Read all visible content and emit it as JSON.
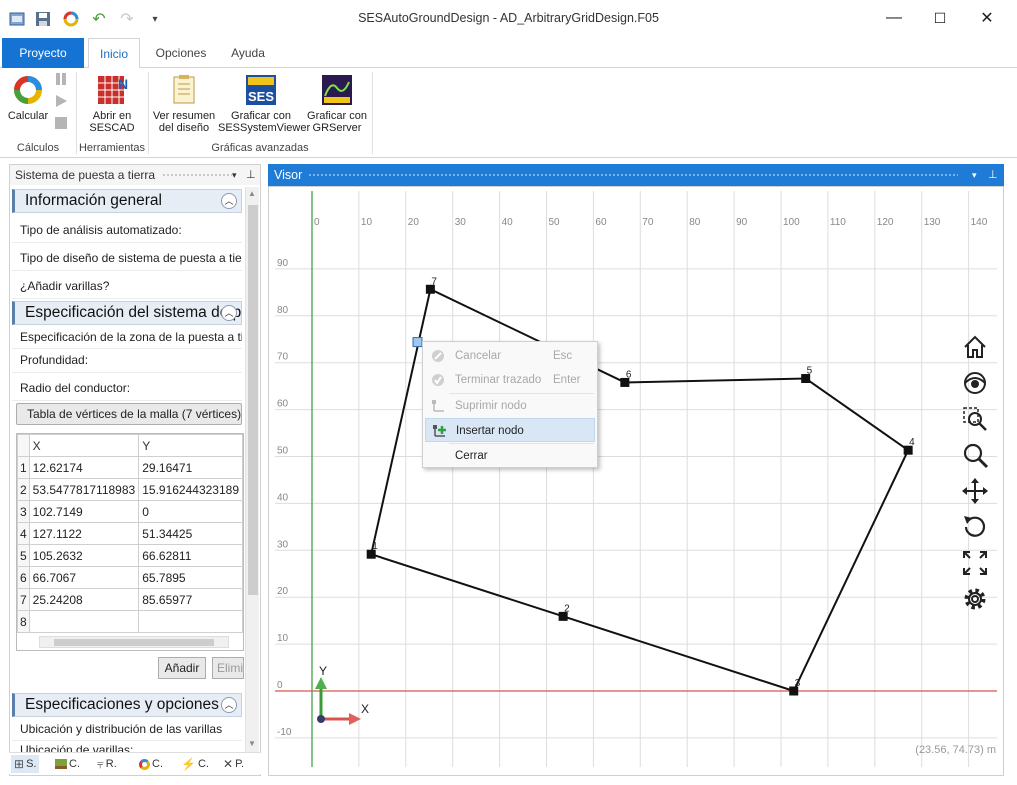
{
  "window": {
    "title": "SESAutoGroundDesign - AD_ArbitraryGridDesign.F05",
    "minimize": "—",
    "maximize": "☐",
    "close": "✕"
  },
  "ribbon": {
    "tabs": [
      "Proyecto",
      "Inicio",
      "Opciones",
      "Ayuda"
    ],
    "buttons": {
      "calcular": "Calcular",
      "abrir1": "Abrir en",
      "abrir2": "SESCAD",
      "resumen1": "Ver resumen",
      "resumen2": "del diseño",
      "sesview1": "Graficar con",
      "sesview2": "SESSystemViewer",
      "grserver1": "Graficar con",
      "grserver2": "GRServer"
    },
    "groups": {
      "calculos": "Cálculos",
      "herramientas": "Herramientas",
      "graficas": "Gráficas avanzadas"
    }
  },
  "left_panel": {
    "title": "Sistema de puesta a tierra",
    "sections": {
      "general": "Información general",
      "spec": "Especificación del sistema de puesta a tierra",
      "options": "Especificaciones y opciones"
    },
    "rows": {
      "analysis_type": "Tipo de análisis automatizado:",
      "design_type": "Tipo de diseño de sistema de puesta a tierra:",
      "add_rods": "¿Añadir varillas?",
      "zone_spec": "Especificación de la zona de la puesta a tierra",
      "depth": "Profundidad:",
      "radius": "Radio del conductor:",
      "vertex_table": "Tabla de vértices de la malla (7 vértices)",
      "rod_location": "Ubicación y distribución de las varillas",
      "rod_location2": "Ubicación de varillas:"
    },
    "table": {
      "headers": [
        "X",
        "Y"
      ],
      "rows": [
        {
          "n": "1",
          "x": "12.62174",
          "y": "29.16471"
        },
        {
          "n": "2",
          "x": "53.5477817118983",
          "y": "15.916244323189"
        },
        {
          "n": "3",
          "x": "102.7149",
          "y": "0"
        },
        {
          "n": "4",
          "x": "127.1122",
          "y": "51.34425"
        },
        {
          "n": "5",
          "x": "105.2632",
          "y": "66.62811"
        },
        {
          "n": "6",
          "x": "66.7067",
          "y": "65.7895"
        },
        {
          "n": "7",
          "x": "25.24208",
          "y": "85.65977"
        },
        {
          "n": "8",
          "x": "",
          "y": ""
        }
      ]
    },
    "add_button": "Añadir",
    "delete_button": "Eliminar",
    "bottom_tabs": [
      "S.",
      "C.",
      "R.",
      "C.",
      "C.",
      "P."
    ]
  },
  "viewer": {
    "title": "Visor",
    "x_ticks": [
      "0",
      "10",
      "20",
      "30",
      "40",
      "50",
      "60",
      "70",
      "80",
      "90",
      "100",
      "110",
      "120",
      "130",
      "140"
    ],
    "y_ticks": [
      "90",
      "80",
      "70",
      "60",
      "50",
      "40",
      "30",
      "20",
      "10",
      "0",
      "-10"
    ],
    "axis_x_label": "X",
    "axis_y_label": "Y",
    "nodes": [
      {
        "label": "1",
        "x": 12.62174,
        "y": 29.16471
      },
      {
        "label": "2",
        "x": 53.5477817118983,
        "y": 15.916244323189
      },
      {
        "label": "3",
        "x": 102.7149,
        "y": 0
      },
      {
        "label": "4",
        "x": 127.1122,
        "y": 51.34425
      },
      {
        "label": "5",
        "x": 105.2632,
        "y": 66.62811
      },
      {
        "label": "6",
        "x": 66.7067,
        "y": 65.7895
      },
      {
        "label": "7",
        "x": 25.24208,
        "y": 85.65977
      }
    ],
    "selected_point": {
      "x": 22.5,
      "y": 74.4
    },
    "coordinate_readout": "(23.56, 74.73) m",
    "colors": {
      "grid": "#dddddd",
      "x_axis": "#d9534f",
      "y_axis": "#3a9a3a",
      "header": "#1e7bd6"
    }
  },
  "context_menu": {
    "items": [
      {
        "label": "Cancelar",
        "shortcut": "Esc",
        "enabled": false
      },
      {
        "label": "Terminar trazado",
        "shortcut": "Enter",
        "enabled": false
      },
      {
        "label": "Suprimir nodo",
        "shortcut": "",
        "enabled": false
      },
      {
        "label": "Insertar nodo",
        "shortcut": "",
        "enabled": true
      },
      {
        "label": "Cerrar",
        "shortcut": "",
        "enabled": true
      }
    ]
  }
}
